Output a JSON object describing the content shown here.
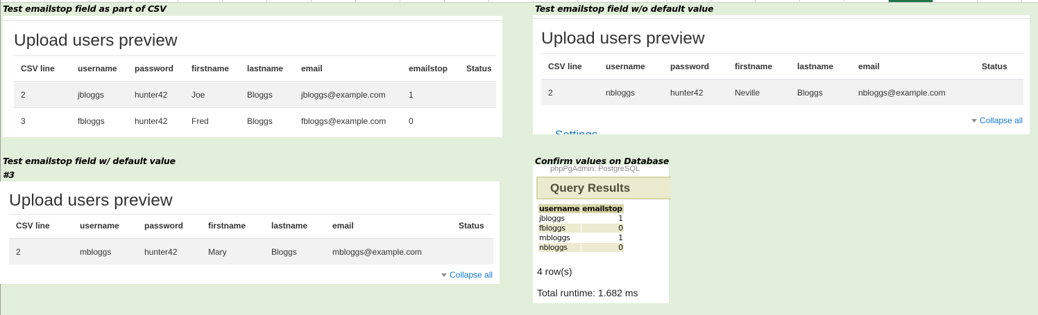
{
  "captions": {
    "csv": "Test emailstop field as part of CSV",
    "no_default": "Test emailstop field w/o default value",
    "with_default": "Test emailstop field w/ default value",
    "with_default_num": "#3",
    "database": "Confirm values on Database"
  },
  "panel1": {
    "title": "Upload users preview",
    "headers": [
      "CSV line",
      "username",
      "password",
      "firstname",
      "lastname",
      "email",
      "emailstop",
      "Status"
    ],
    "rows": [
      [
        "2",
        "jbloggs",
        "hunter42",
        "Joe",
        "Bloggs",
        "jbloggs@example.com",
        "1",
        ""
      ],
      [
        "3",
        "fbloggs",
        "hunter42",
        "Fred",
        "Bloggs",
        "fbloggs@example.com",
        "0",
        ""
      ]
    ]
  },
  "panel2": {
    "title": "Upload users preview",
    "headers": [
      "CSV line",
      "username",
      "password",
      "firstname",
      "lastname",
      "email",
      "Status"
    ],
    "rows": [
      [
        "2",
        "nbloggs",
        "hunter42",
        "Neville",
        "Bloggs",
        "nbloggs@example.com",
        ""
      ]
    ],
    "collapse_label": "Collapse all",
    "settings_label": "Settings"
  },
  "panel3": {
    "title": "Upload users preview",
    "headers": [
      "CSV line",
      "username",
      "password",
      "firstname",
      "lastname",
      "email",
      "Status"
    ],
    "rows": [
      [
        "2",
        "mbloggs",
        "hunter42",
        "Mary",
        "Bloggs",
        "mbloggs@example.com",
        ""
      ]
    ],
    "collapse_label": "Collapse all"
  },
  "query": {
    "breadcrumb": "phpPgAdmin: PostgreSQL",
    "title": "Query Results",
    "headers": [
      "username",
      "emailstop"
    ],
    "rows": [
      [
        "jbloggs",
        "1"
      ],
      [
        "fbloggs",
        "0"
      ],
      [
        "mbloggs",
        "1"
      ],
      [
        "nbloggs",
        "0"
      ]
    ],
    "row_count": "4 row(s)",
    "runtime": "Total runtime: 1.682 ms"
  }
}
